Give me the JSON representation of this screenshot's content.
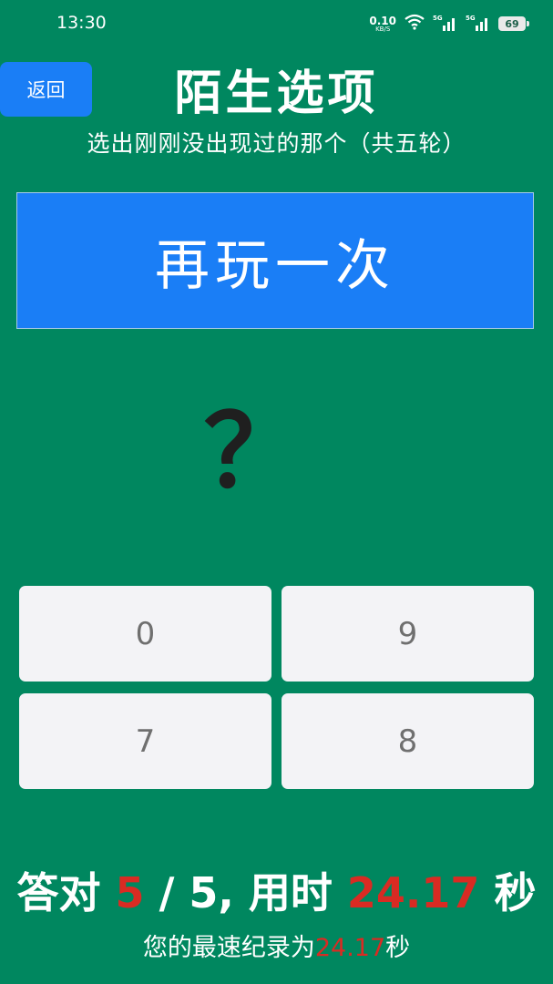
{
  "status_bar": {
    "time": "13:30",
    "net_speed_value": "0.10",
    "net_speed_unit": "KB/S",
    "sim1_tag": "5G",
    "sim2_tag": "5G",
    "battery": "69",
    "icons": [
      "wifi-icon",
      "signal-icon",
      "signal-icon",
      "battery-icon"
    ]
  },
  "header": {
    "back_label": "返回",
    "title": "陌生选项",
    "subtitle": "选出刚刚没出现过的那个（共五轮）"
  },
  "replay_button_label": "再玩一次",
  "question_symbol": "？",
  "options": [
    "0",
    "9",
    "7",
    "8"
  ],
  "result": {
    "prefix": "答对",
    "correct": "5",
    "separator": "/",
    "total": "5,",
    "time_prefix": "用时",
    "time_value": "24.17",
    "time_unit": "秒"
  },
  "best_record": {
    "prefix": "您的最速纪录为",
    "value": "24.17",
    "unit": "秒"
  },
  "colors": {
    "background": "#00875f",
    "accent_blue": "#1a7ef6",
    "highlight_red": "#d92b23",
    "option_bg": "#f3f3f6"
  }
}
